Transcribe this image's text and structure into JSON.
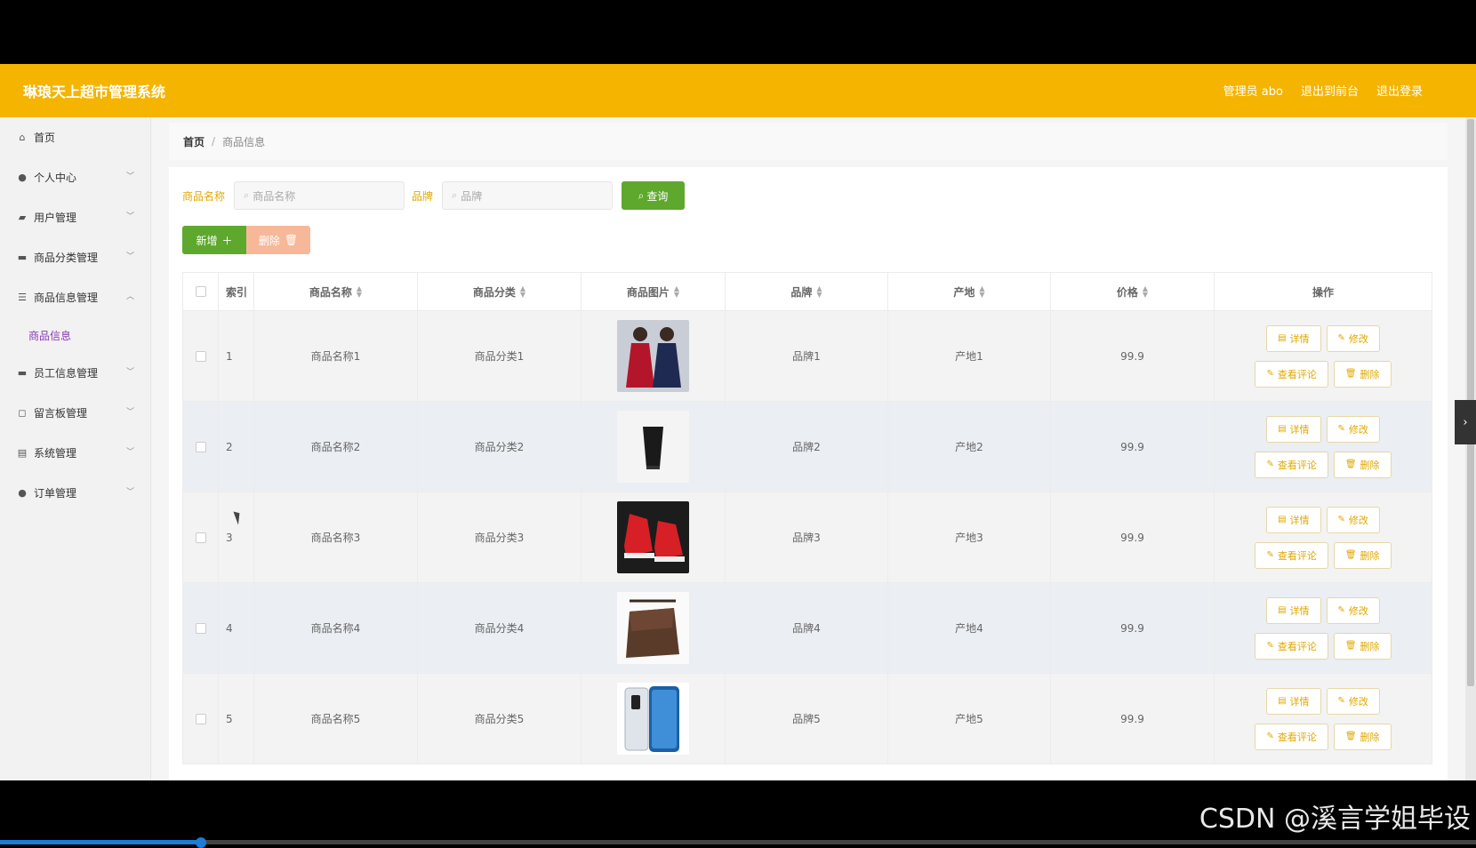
{
  "header": {
    "title": "琳琅天上超市管理系统",
    "admin": "管理员 abo",
    "back_front": "退出到前台",
    "logout": "退出登录",
    "bg_color": "#f5b400"
  },
  "sidebar": {
    "items": [
      {
        "icon": "home-icon",
        "label": "首页"
      },
      {
        "icon": "user-icon",
        "label": "个人中心"
      },
      {
        "icon": "users-icon",
        "label": "用户管理"
      },
      {
        "icon": "category-icon",
        "label": "商品分类管理"
      },
      {
        "icon": "list-icon",
        "label": "商品信息管理"
      },
      {
        "icon": "staff-icon",
        "label": "员工信息管理"
      },
      {
        "icon": "message-icon",
        "label": "留言板管理"
      },
      {
        "icon": "system-icon",
        "label": "系统管理"
      },
      {
        "icon": "location-icon",
        "label": "订单管理"
      }
    ],
    "sub_item": "商品信息"
  },
  "breadcrumb": {
    "home": "首页",
    "sep": "/",
    "current": "商品信息"
  },
  "search": {
    "name_label": "商品名称",
    "name_placeholder": "商品名称",
    "brand_label": "品牌",
    "brand_placeholder": "品牌",
    "query_button": "查询"
  },
  "actions": {
    "add": "新增",
    "delete": "删除"
  },
  "table": {
    "headers": [
      "索引",
      "商品名称",
      "商品分类",
      "商品图片",
      "品牌",
      "产地",
      "价格",
      "操作"
    ],
    "rows": [
      {
        "index": "1",
        "name": "商品名称1",
        "category": "商品分类1",
        "image": "clothing-photo",
        "brand": "品牌1",
        "origin": "产地1",
        "price": "99.9"
      },
      {
        "index": "2",
        "name": "商品名称2",
        "category": "商品分类2",
        "image": "cosmetic-tube-photo",
        "brand": "品牌2",
        "origin": "产地2",
        "price": "99.9"
      },
      {
        "index": "3",
        "name": "商品名称3",
        "category": "商品分类3",
        "image": "red-sneakers-photo",
        "brand": "品牌3",
        "origin": "产地3",
        "price": "99.9"
      },
      {
        "index": "4",
        "name": "商品名称4",
        "category": "商品分类4",
        "image": "brown-bag-photo",
        "brand": "品牌4",
        "origin": "产地4",
        "price": "99.9"
      },
      {
        "index": "5",
        "name": "商品名称5",
        "category": "商品分类5",
        "image": "smartphone-photo",
        "brand": "品牌5",
        "origin": "产地5",
        "price": "99.9"
      }
    ],
    "ops": {
      "detail": "详情",
      "edit": "修改",
      "comments": "查看评论",
      "delete": "删除"
    }
  },
  "watermark": "CSDN @溪言学姐毕设"
}
